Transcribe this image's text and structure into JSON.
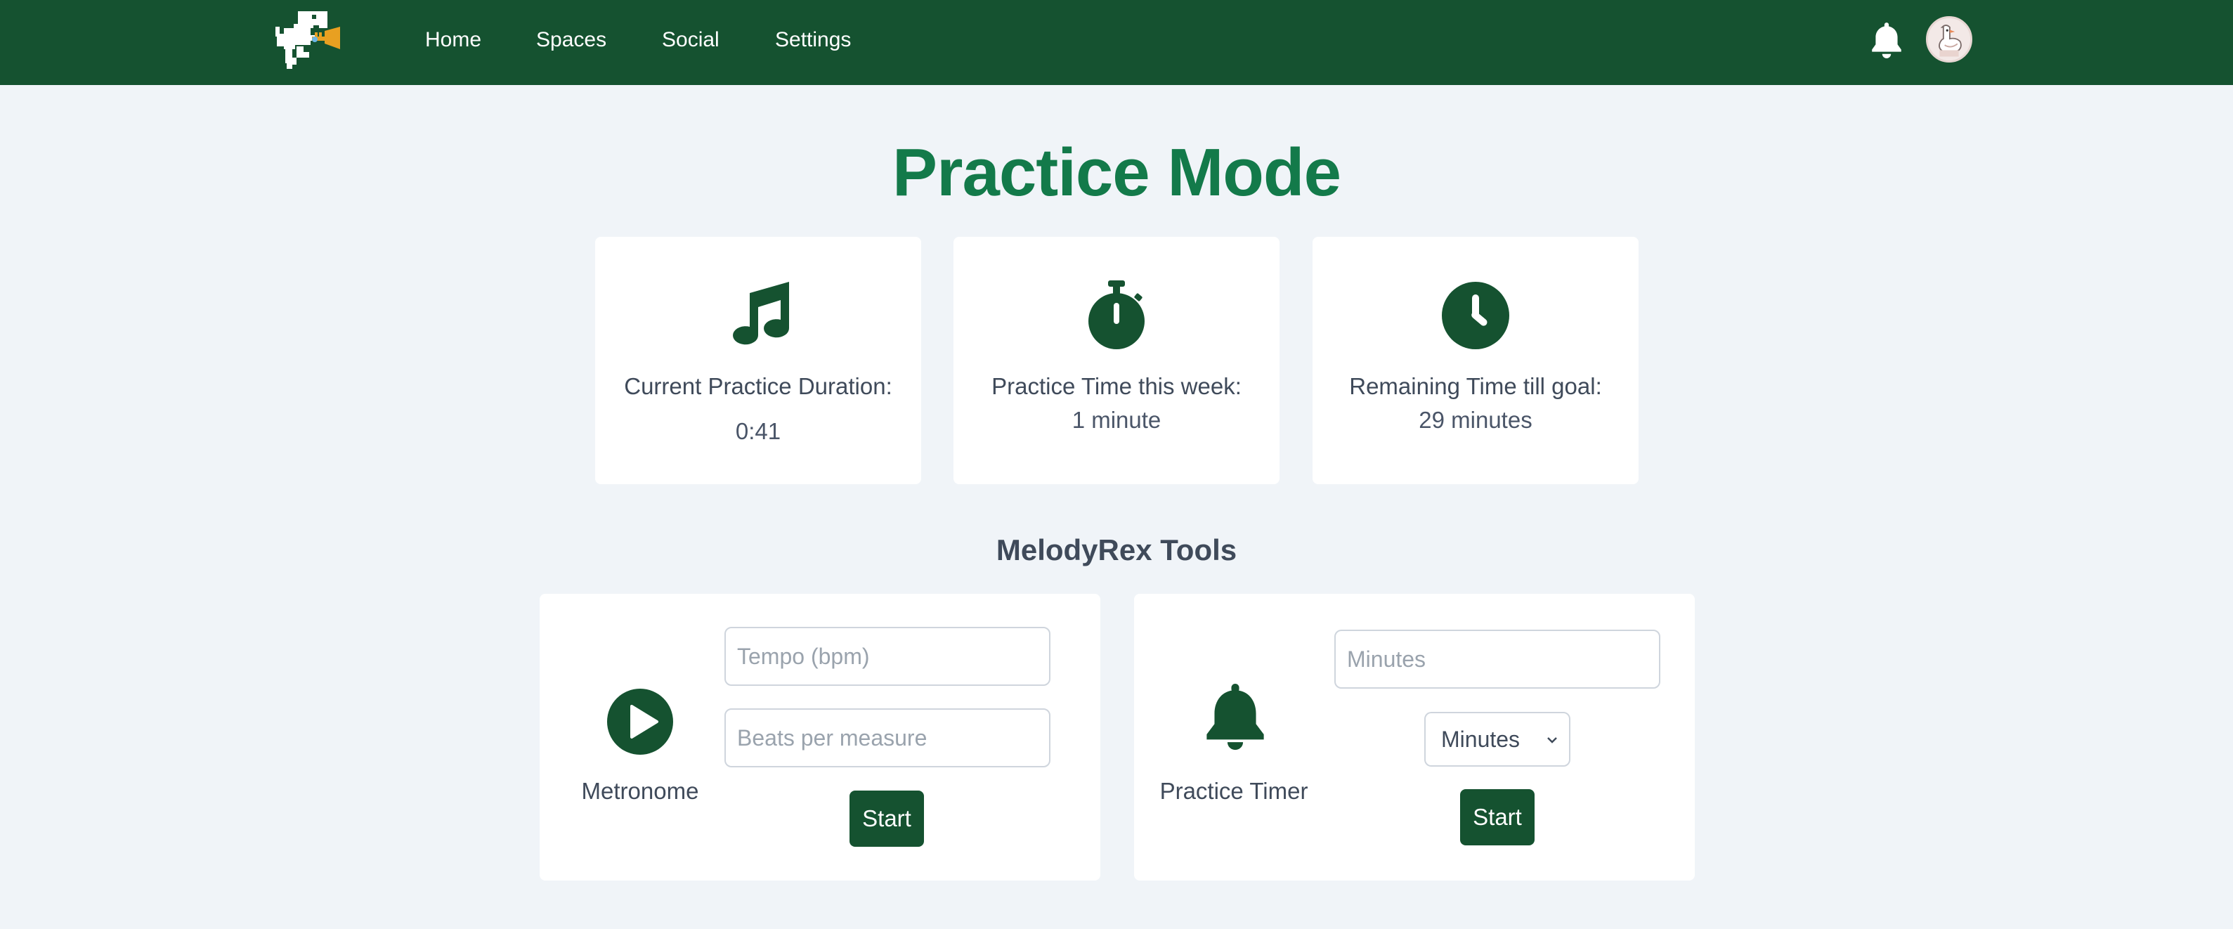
{
  "nav": {
    "links": [
      "Home",
      "Spaces",
      "Social",
      "Settings"
    ],
    "logo_icon": "trumpet-dino-logo",
    "notification_icon": "bell-icon",
    "avatar_icon": "goose-avatar"
  },
  "page": {
    "title": "Practice Mode"
  },
  "stats": [
    {
      "icon": "music-note-icon",
      "label": "Current Practice Duration:",
      "value": "0:41"
    },
    {
      "icon": "stopwatch-icon",
      "label": "Practice Time this week:",
      "value": "1 minute"
    },
    {
      "icon": "clock-icon",
      "label": "Remaining Time till goal:",
      "value": "29 minutes"
    }
  ],
  "tools": {
    "heading": "MelodyRex Tools",
    "metronome": {
      "icon": "play-circle-icon",
      "label": "Metronome",
      "tempo_placeholder": "Tempo (bpm)",
      "beats_placeholder": "Beats per measure",
      "start_label": "Start"
    },
    "timer": {
      "icon": "bell-icon",
      "label": "Practice Timer",
      "minutes_placeholder": "Minutes",
      "unit_selected": "Minutes",
      "start_label": "Start"
    }
  },
  "colors": {
    "brand_green": "#155230",
    "title_green": "#137a4a",
    "page_bg": "#f0f4f8",
    "card_bg": "#ffffff",
    "text": "#3f4a5a"
  }
}
